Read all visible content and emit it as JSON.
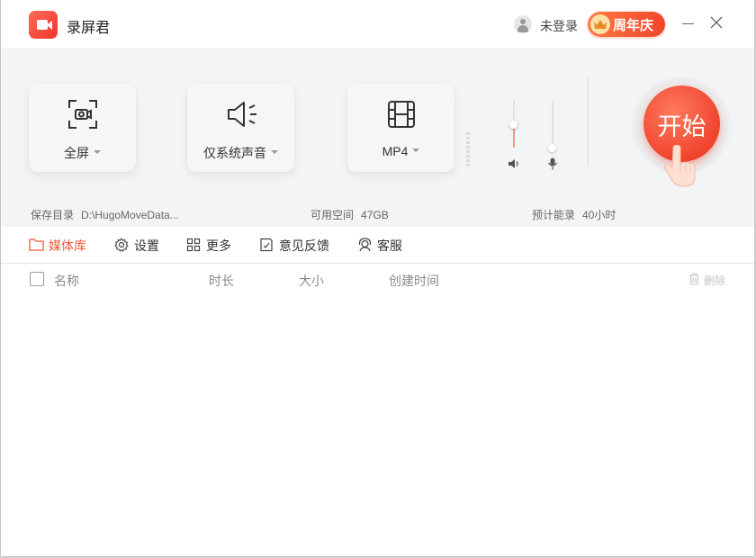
{
  "app": {
    "title": "录屏君"
  },
  "account": {
    "login_label": "未登录",
    "promo_label": "周年庆"
  },
  "controls": {
    "area_label": "全屏",
    "audio_label": "仅系统声音",
    "format_label": "MP4",
    "speaker_volume": 0.5,
    "mic_volume": 0.0,
    "start_label": "开始"
  },
  "info": {
    "save_dir_label": "保存目录",
    "save_dir_value": "D:\\HugoMoveData...",
    "free_space_label": "可用空间",
    "free_space_value": "47GB",
    "est_label": "预计能录",
    "est_value": "40小时"
  },
  "tabs": [
    {
      "label": "媒体库",
      "active": true
    },
    {
      "label": "设置"
    },
    {
      "label": "更多"
    },
    {
      "label": "意见反馈"
    },
    {
      "label": "客服"
    }
  ],
  "table": {
    "columns": [
      "名称",
      "时长",
      "大小",
      "创建时间"
    ],
    "delete_label": "删除",
    "rows": []
  },
  "colors": {
    "accent": "#ef5a3c",
    "start_button": "#f0442d"
  }
}
